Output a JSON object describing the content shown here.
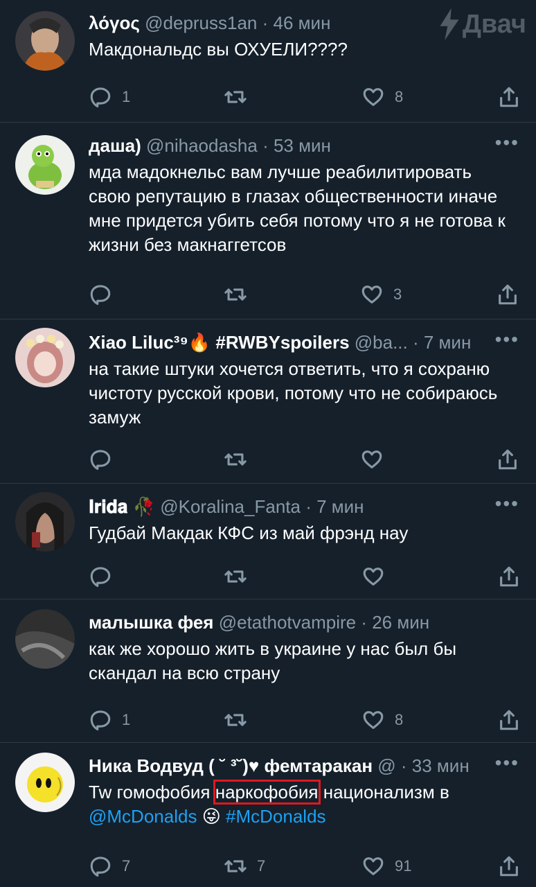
{
  "watermark": {
    "text": "Двач"
  },
  "tweets": [
    {
      "name": "λόγος",
      "handle": "@depruss1an",
      "time": "· 46 мин",
      "text": "Макдональдс вы ОХУЕЛИ????",
      "replies": "1",
      "retweets": "",
      "likes": "8",
      "avatar_color": "#4a3a30"
    },
    {
      "name": "даша)",
      "handle": "@nihaodasha",
      "time": "· 53 мин",
      "text": "мда мадокнельс вам лучше реабилитировать свою репутацию в глазах общественности иначе мне придется убить себя потому что я не готова к жизни без макнаггетсов",
      "replies": "",
      "retweets": "",
      "likes": "3",
      "avatar_color": "#e8ece6"
    },
    {
      "name": "Xiao Liluc³⁹🔥 #RWBYspoilers",
      "handle": "@ba...",
      "time": "· 7 мин",
      "text": "на такие штуки хочется ответить, что я сохраню чистоту русской крови, потому что не собираюсь замуж",
      "replies": "",
      "retweets": "",
      "likes": "",
      "avatar_color": "#d7a6a8"
    },
    {
      "name": "𝐈𝐫𝐢𝐝𝐚 🥀",
      "handle": "@Koralina_Fanta",
      "time": "· 7 мин",
      "text": "Гудбай Макдак КФС из май фрэнд нау",
      "replies": "",
      "retweets": "",
      "likes": "",
      "avatar_color": "#5a3b38"
    },
    {
      "name": "малышка фея",
      "handle": "@etathotvampire",
      "time": "· 26 мин",
      "text": "как же хорошо жить в украине у нас был бы скандал на всю страну",
      "replies": "1",
      "retweets": "",
      "likes": "8",
      "avatar_color": "#3a3a3a"
    },
    {
      "name": "Ника Водвуд ( ˘ ³˘)♥ фемтаракан",
      "handle": "@",
      "time": "· 33 мин",
      "text_parts": {
        "pre": "Tw гомофобия ",
        "highlight": "наркофобия",
        "post": " национализм в",
        "link1": "@McDonalds",
        "emoji": "😜",
        "link2": "#McDonalds"
      },
      "replies": "7",
      "retweets": "7",
      "likes": "91",
      "avatar_color": "#f2f2f2"
    }
  ]
}
